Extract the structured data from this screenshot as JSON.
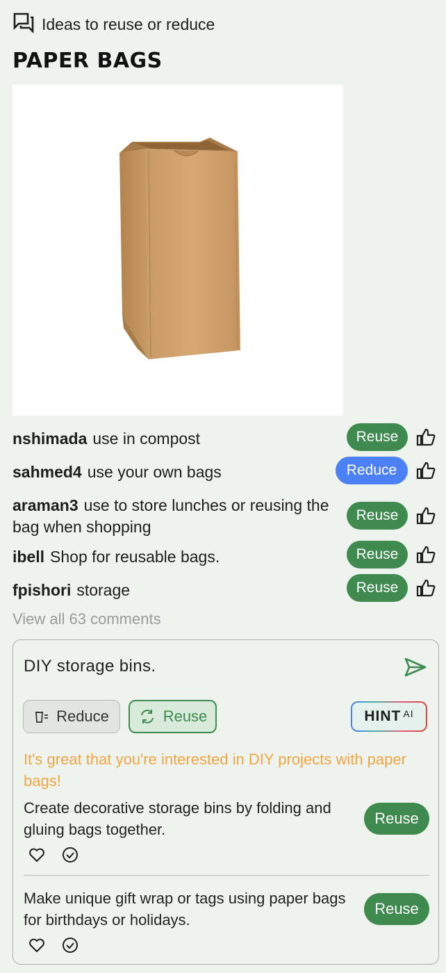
{
  "header": {
    "section_label": "Ideas to reuse or reduce",
    "item_title": "PAPER BAGS",
    "icon": "comments-icon"
  },
  "comments": [
    {
      "user": "nshimada",
      "text": "use in compost",
      "tag": "Reuse"
    },
    {
      "user": "sahmed4",
      "text": "use your own bags",
      "tag": "Reduce"
    },
    {
      "user": "araman3",
      "text": "use to store lunches or reusing the bag when shopping",
      "tag": "Reuse"
    },
    {
      "user": "ibell",
      "text": "Shop for reusable bags.",
      "tag": "Reuse"
    },
    {
      "user": "fpishori",
      "text": "storage",
      "tag": "Reuse"
    }
  ],
  "view_all": "View all 63 comments",
  "composer": {
    "input_value": "DIY storage bins.",
    "reduce_label": "Reduce",
    "reuse_label": "Reuse",
    "hint_label": "HINT",
    "hint_sup": "AI",
    "ai_intro": "It's great that you're interested in DIY projects with paper bags!",
    "suggestions": [
      {
        "text": "Create decorative storage bins by folding and gluing bags together.",
        "tag": "Reuse"
      },
      {
        "text": "Make unique gift wrap or tags using paper bags for birthdays or holidays.",
        "tag": "Reuse"
      }
    ]
  },
  "colors": {
    "background": "#eef3ee",
    "reuse_green": "#3f8a4f",
    "reduce_blue": "#4c80f5",
    "ai_orange": "#f0a545"
  }
}
